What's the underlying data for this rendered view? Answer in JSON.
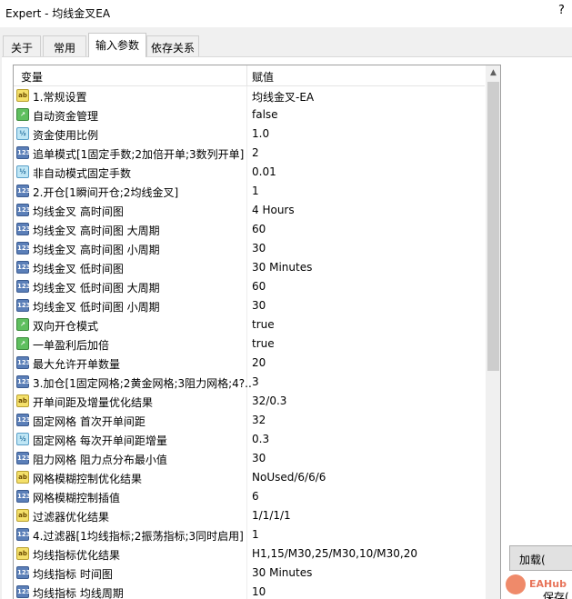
{
  "window": {
    "title": "Expert - 均线金叉EA",
    "help": "?"
  },
  "tabs": [
    {
      "label": "关于"
    },
    {
      "label": "常用"
    },
    {
      "label": "输入参数"
    },
    {
      "label": "依存关系"
    }
  ],
  "grid": {
    "col_variable": "变量",
    "col_value": "赋值",
    "rows": [
      {
        "type": "ab",
        "type_glyph": "ab",
        "name": "1.常规设置",
        "value": "均线金叉-EA"
      },
      {
        "type": "bool",
        "type_glyph": "↗",
        "name": "自动资金管理",
        "value": "false"
      },
      {
        "type": "dbl",
        "type_glyph": "½",
        "name": "资金使用比例",
        "value": "1.0"
      },
      {
        "type": "int",
        "type_glyph": "123",
        "name": "追单模式[1固定手数;2加倍开单;3数列开单]",
        "value": "2"
      },
      {
        "type": "dbl",
        "type_glyph": "½",
        "name": "非自动模式固定手数",
        "value": "0.01"
      },
      {
        "type": "int",
        "type_glyph": "123",
        "name": "2.开仓[1瞬间开仓;2均线金叉]",
        "value": "1"
      },
      {
        "type": "int",
        "type_glyph": "123",
        "name": "均线金叉 高时间图",
        "value": "4 Hours"
      },
      {
        "type": "int",
        "type_glyph": "123",
        "name": "均线金叉 高时间图 大周期",
        "value": "60"
      },
      {
        "type": "int",
        "type_glyph": "123",
        "name": "均线金叉 高时间图 小周期",
        "value": "30"
      },
      {
        "type": "int",
        "type_glyph": "123",
        "name": "均线金叉 低时间图",
        "value": "30 Minutes"
      },
      {
        "type": "int",
        "type_glyph": "123",
        "name": "均线金叉 低时间图 大周期",
        "value": "60"
      },
      {
        "type": "int",
        "type_glyph": "123",
        "name": "均线金叉 低时间图 小周期",
        "value": "30"
      },
      {
        "type": "bool",
        "type_glyph": "↗",
        "name": "双向开仓模式",
        "value": "true"
      },
      {
        "type": "bool",
        "type_glyph": "↗",
        "name": "一单盈利后加倍",
        "value": "true"
      },
      {
        "type": "int",
        "type_glyph": "123",
        "name": "最大允许开单数量",
        "value": "20"
      },
      {
        "type": "int",
        "type_glyph": "123",
        "name": "3.加仓[1固定网格;2黄金网格;3阻力网格;4?..",
        "value": "3"
      },
      {
        "type": "ab",
        "type_glyph": "ab",
        "name": "开单间距及增量优化结果",
        "value": "32/0.3"
      },
      {
        "type": "int",
        "type_glyph": "123",
        "name": "固定网格 首次开单间距",
        "value": "32"
      },
      {
        "type": "dbl",
        "type_glyph": "½",
        "name": "固定网格 每次开单间距增量",
        "value": "0.3"
      },
      {
        "type": "int",
        "type_glyph": "123",
        "name": "阻力网格 阻力点分布最小值",
        "value": "30"
      },
      {
        "type": "ab",
        "type_glyph": "ab",
        "name": "网格模糊控制优化结果",
        "value": "NoUsed/6/6/6"
      },
      {
        "type": "int",
        "type_glyph": "123",
        "name": "网格模糊控制插值",
        "value": "6"
      },
      {
        "type": "ab",
        "type_glyph": "ab",
        "name": "过滤器优化结果",
        "value": "1/1/1/1"
      },
      {
        "type": "int",
        "type_glyph": "123",
        "name": "4.过滤器[1均线指标;2振荡指标;3同时启用]",
        "value": "1"
      },
      {
        "type": "ab",
        "type_glyph": "ab",
        "name": "均线指标优化结果",
        "value": "H1,15/M30,25/M30,10/M30,20"
      },
      {
        "type": "int",
        "type_glyph": "123",
        "name": "均线指标 时间图",
        "value": "30 Minutes"
      },
      {
        "type": "int",
        "type_glyph": "123",
        "name": "均线指标 均线周期",
        "value": "10"
      }
    ]
  },
  "buttons": {
    "load": "加载(",
    "save": "保存("
  },
  "watermark": {
    "text": "EAHub"
  },
  "colors": {
    "selected_tab": "#ffffff",
    "window_bg": "#f0f0f0"
  }
}
